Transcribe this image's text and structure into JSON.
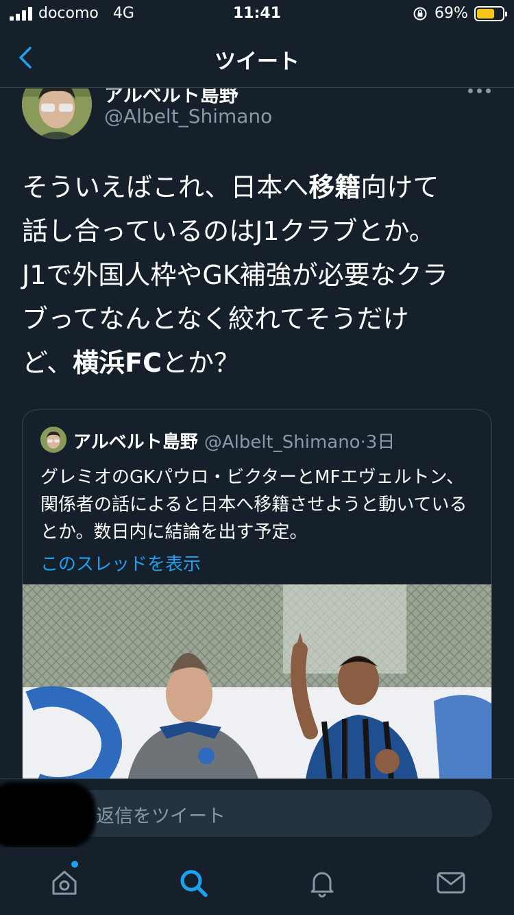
{
  "status_bar": {
    "carrier": "docomo",
    "network": "4G",
    "time": "11:41",
    "battery_percent": "69%",
    "battery_level": 0.69,
    "battery_color": "#f5c518",
    "icons": [
      "signal-icon",
      "orientation-lock-icon",
      "battery-icon"
    ]
  },
  "nav": {
    "title": "ツイート",
    "back_icon": "chevron-left-icon"
  },
  "tweet": {
    "author_name": "アルベルト島野",
    "author_handle": "@Albelt_Shimano",
    "more_icon": "more-horizontal-icon",
    "text_parts": {
      "p1": "そういえばこれ、日本へ",
      "b1": "移籍",
      "p2": "向けて",
      "p3": "話し合っているのはJ1クラブとか。",
      "p4": "J1で外国人枠やGK補強が必要なクラ",
      "p5": "ブってなんとなく絞れてそうだけ",
      "p6": "ど、",
      "b2": "横浜FC",
      "p7": "とか？"
    }
  },
  "quote": {
    "author_name": "アルベルト島野",
    "author_handle": "@Albelt_Shimano",
    "separator": "·",
    "time": "3日",
    "text": "グレミオのGKパウロ・ビクターとMFエヴェルトン、関係者の話によると日本へ移籍させようと動いているとか。数日内に結論を出す予定。",
    "thread_link": "このスレッドを表示"
  },
  "reply": {
    "placeholder": "返信をツイート"
  },
  "tabbar": {
    "items": [
      "home-icon",
      "search-icon",
      "notifications-icon",
      "messages-icon"
    ],
    "active": "search-icon",
    "accent": "#1da1f2"
  },
  "colors": {
    "background": "#15202b",
    "secondary_text": "#8899a6",
    "border": "#38444d",
    "link": "#1da1f2"
  }
}
